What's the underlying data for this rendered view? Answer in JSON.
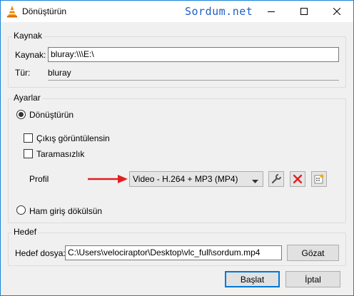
{
  "window": {
    "title": "Dönüştürün",
    "watermark": "Sordum.net"
  },
  "source": {
    "group_title": "Kaynak",
    "source_label": "Kaynak:",
    "source_value": "bluray:\\\\\\E:\\",
    "type_label": "Tür:",
    "type_value": "bluray"
  },
  "settings": {
    "group_title": "Ayarlar",
    "convert_radio_label": "Dönüştürün",
    "convert_checked": true,
    "display_output_label": "Çıkış görüntülensin",
    "deinterlace_label": "Taramasızlık",
    "profile_label": "Profil",
    "profile_selected": "Video - H.264 + MP3 (MP4)",
    "dump_raw_label": "Ham giriş dökülsün"
  },
  "destination": {
    "group_title": "Hedef",
    "file_label": "Hedef dosya:",
    "file_value": "C:\\Users\\velociraptor\\Desktop\\vlc_full\\sordum.mp4",
    "browse_label": "Gözat"
  },
  "buttons": {
    "start_label": "Başlat",
    "cancel_label": "İptal"
  },
  "colors": {
    "accent": "#0078d7",
    "arrow": "#e02020",
    "delete_icon": "#e02020"
  }
}
